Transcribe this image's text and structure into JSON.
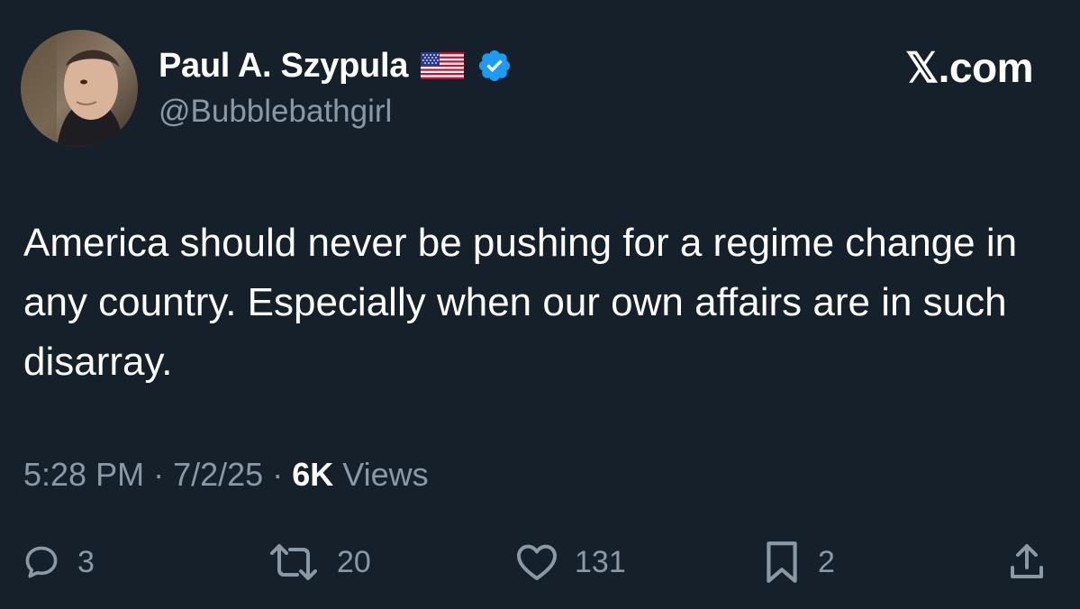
{
  "author": {
    "display_name": "Paul A. Szypula",
    "handle": "@Bubblebathgirl",
    "verified": true,
    "flag_icon": "us-flag-icon"
  },
  "brand": "𝕏.com",
  "tweet": {
    "text": "America should never be pushing for a regime change in any country. Especially when our own affairs are in such disarray.",
    "time": "5:28 PM",
    "date": "7/2/25",
    "views_count": "6K",
    "views_label": "Views"
  },
  "actions": {
    "replies": "3",
    "reposts": "20",
    "likes": "131",
    "bookmarks": "2"
  },
  "colors": {
    "background": "#15202b",
    "text_primary": "#ffffff",
    "text_secondary": "#8b98a5",
    "verified_blue": "#1d9bf0"
  }
}
